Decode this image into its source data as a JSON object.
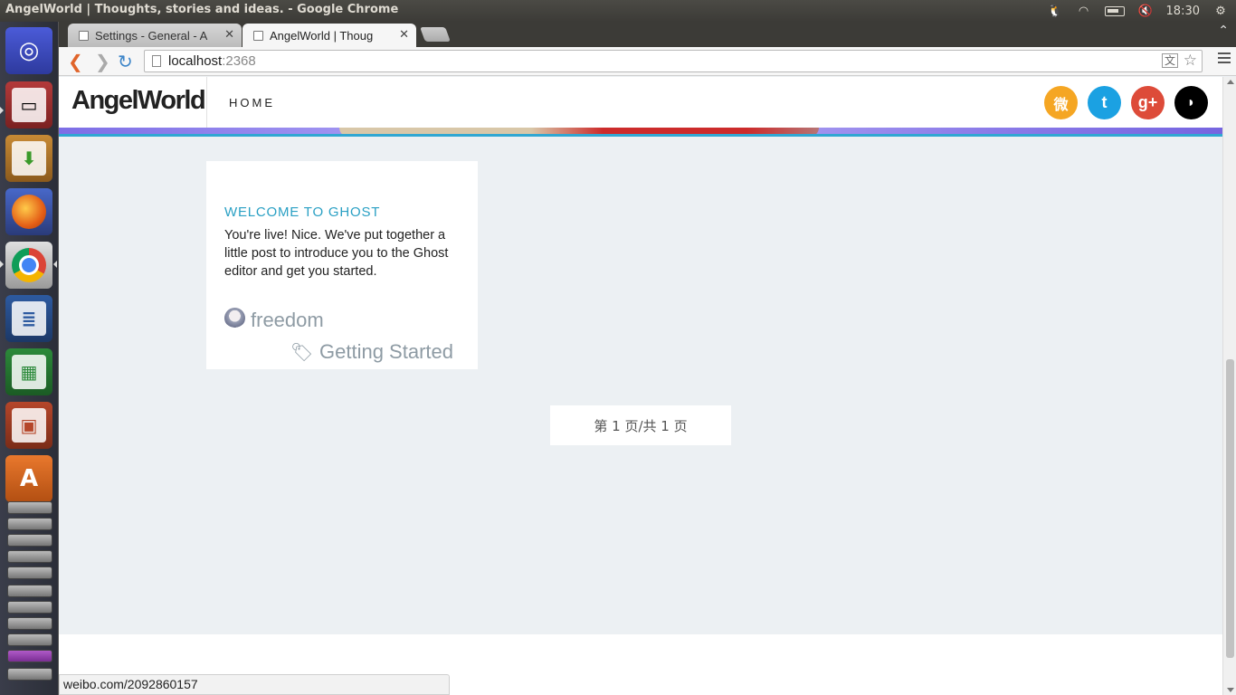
{
  "system": {
    "window_title": "AngelWorld | Thoughts, stories and ideas. - Google Chrome",
    "clock": "18:30"
  },
  "browser": {
    "tabs": [
      {
        "label": "Settings - General - A",
        "active": false
      },
      {
        "label": "AngelWorld | Thoug",
        "active": true
      }
    ],
    "address": {
      "host": "localhost",
      "port": ":2368"
    },
    "status_url": "weibo.com/2092860157"
  },
  "site": {
    "brand": "AngelWorld",
    "nav": {
      "home": "HOME"
    },
    "social": {
      "weibo": "微",
      "twitter": "t",
      "gplus": "g+",
      "rss": "◗"
    }
  },
  "post": {
    "title": "WELCOME TO GHOST",
    "excerpt": "You're live! Nice. We've put together a little post to introduce you to the Ghost editor and get you started.",
    "author": "freedom",
    "tag": "Getting Started"
  },
  "pagination": {
    "label": "第 1 页/共 1 页"
  },
  "colors": {
    "accent": "#2aa0c4",
    "weibo": "#f5a623",
    "twitter": "#1ba1e2",
    "gplus": "#dd4b39",
    "rss": "#000000"
  }
}
